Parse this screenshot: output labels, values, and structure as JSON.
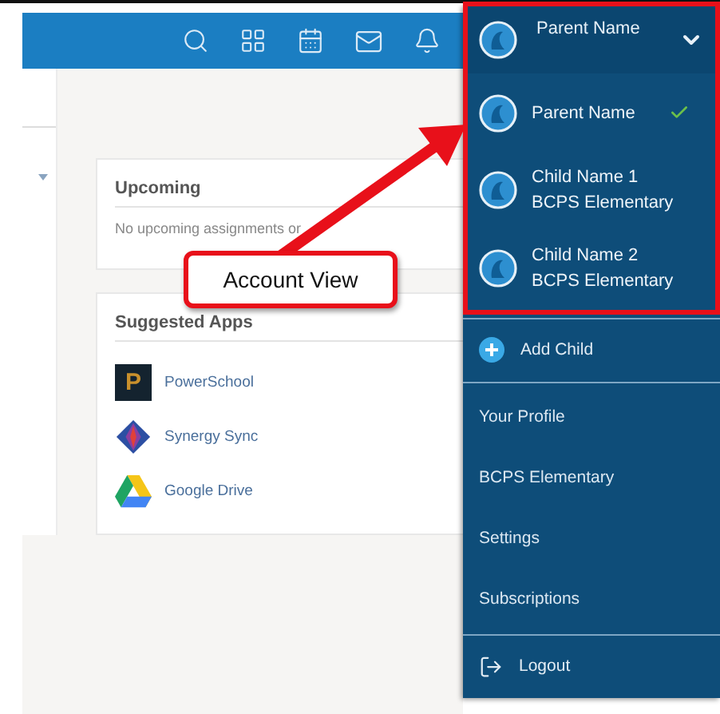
{
  "upcoming": {
    "title": "Upcoming",
    "message": "No upcoming assignments or"
  },
  "suggested_apps": {
    "title": "Suggested Apps",
    "apps": [
      {
        "name": "PowerSchool",
        "kind": "powerschool",
        "logo_letter": "P"
      },
      {
        "name": "Synergy Sync",
        "kind": "synergy"
      },
      {
        "name": "Google Drive",
        "kind": "drive"
      }
    ]
  },
  "account_menu": {
    "current": "Parent Name",
    "expanded": true,
    "accounts": [
      {
        "name": "Parent Name",
        "selected": true
      },
      {
        "name": "Child Name 1",
        "school": "BCPS Elementary",
        "selected": false
      },
      {
        "name": "Child Name 2",
        "school": "BCPS Elementary",
        "selected": false
      }
    ],
    "add_child": "Add Child",
    "links": [
      "Your Profile",
      "BCPS Elementary",
      "Settings",
      "Subscriptions"
    ],
    "logout": "Logout"
  },
  "annotation": {
    "label": "Account View"
  }
}
